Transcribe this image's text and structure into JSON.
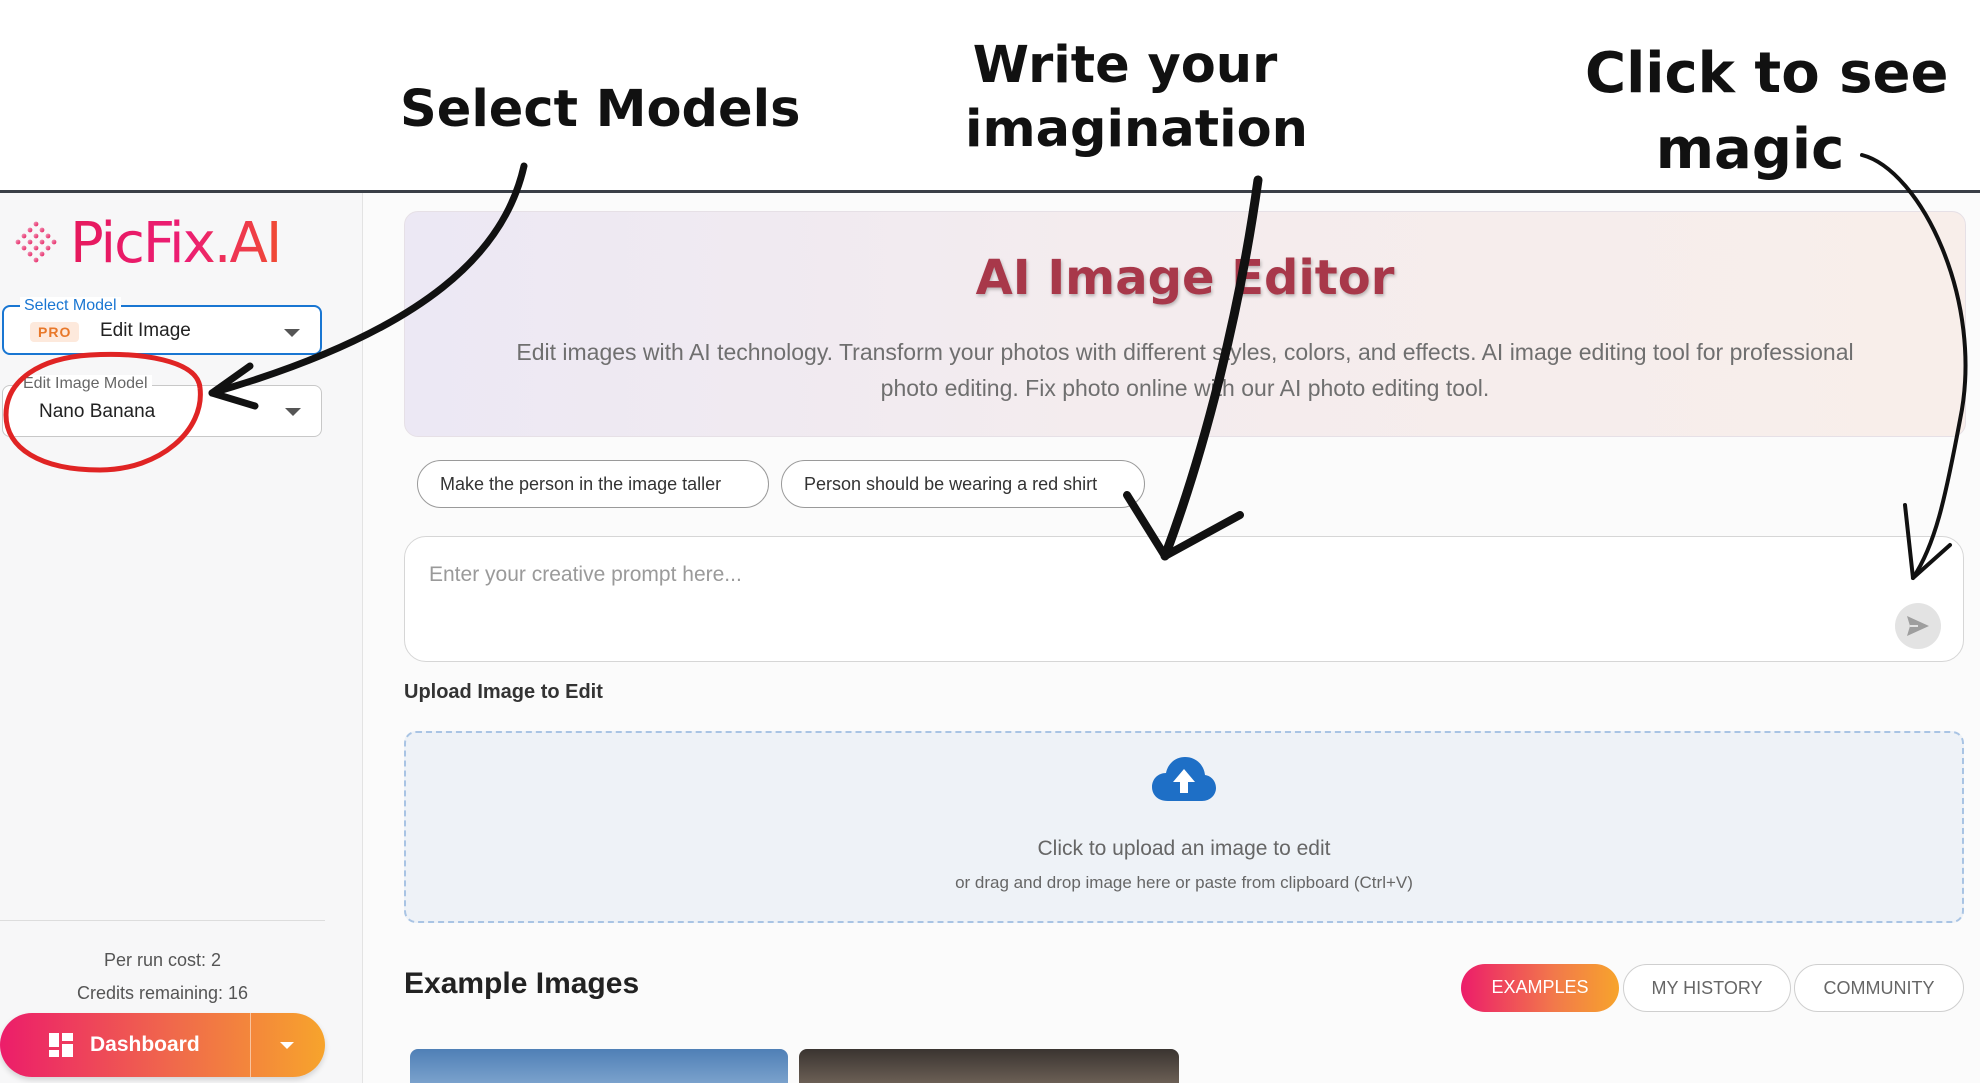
{
  "annotations": {
    "select_models": "Select Models",
    "imagination_line1": "Write your",
    "imagination_line2": "imagination",
    "magic_line1": "Click to see",
    "magic_line2": "magic"
  },
  "brand": {
    "name": "PicFix.AI"
  },
  "sidebar": {
    "select_model_label": "Select Model",
    "select_model_badge": "PRO",
    "select_model_value": "Edit Image",
    "image_model_label": "Edit Image Model",
    "image_model_value": "Nano Banana",
    "per_run_cost": "Per run cost: 2",
    "credits_remaining": "Credits remaining: 16",
    "dashboard_label": "Dashboard"
  },
  "hero": {
    "title": "AI Image Editor",
    "subtitle": "Edit images with AI technology. Transform your photos with different styles, colors, and effects. AI image editing tool for professional photo editing. Fix photo online with our AI photo editing tool."
  },
  "suggestions": [
    "Make the person in the image taller",
    "Person should be wearing a red shirt"
  ],
  "prompt": {
    "placeholder": "Enter your creative prompt here..."
  },
  "upload": {
    "label": "Upload Image to Edit",
    "main_text": "Click to upload an image to edit",
    "sub_text": "or drag and drop image here or paste from clipboard (Ctrl+V)"
  },
  "examples": {
    "title": "Example Images",
    "tabs": [
      "EXAMPLES",
      "MY HISTORY",
      "COMMUNITY"
    ],
    "active_tab": "EXAMPLES"
  },
  "colors": {
    "accent_blue": "#1976d2",
    "brand_pink": "#ec1d6a",
    "brand_orange": "#f7a42c",
    "annotation_red": "#e02424",
    "hero_title": "#a8384a"
  },
  "icons": [
    "diamond-logo-icon",
    "caret-down-icon",
    "dashboard-grid-icon",
    "send-icon",
    "cloud-upload-icon"
  ]
}
